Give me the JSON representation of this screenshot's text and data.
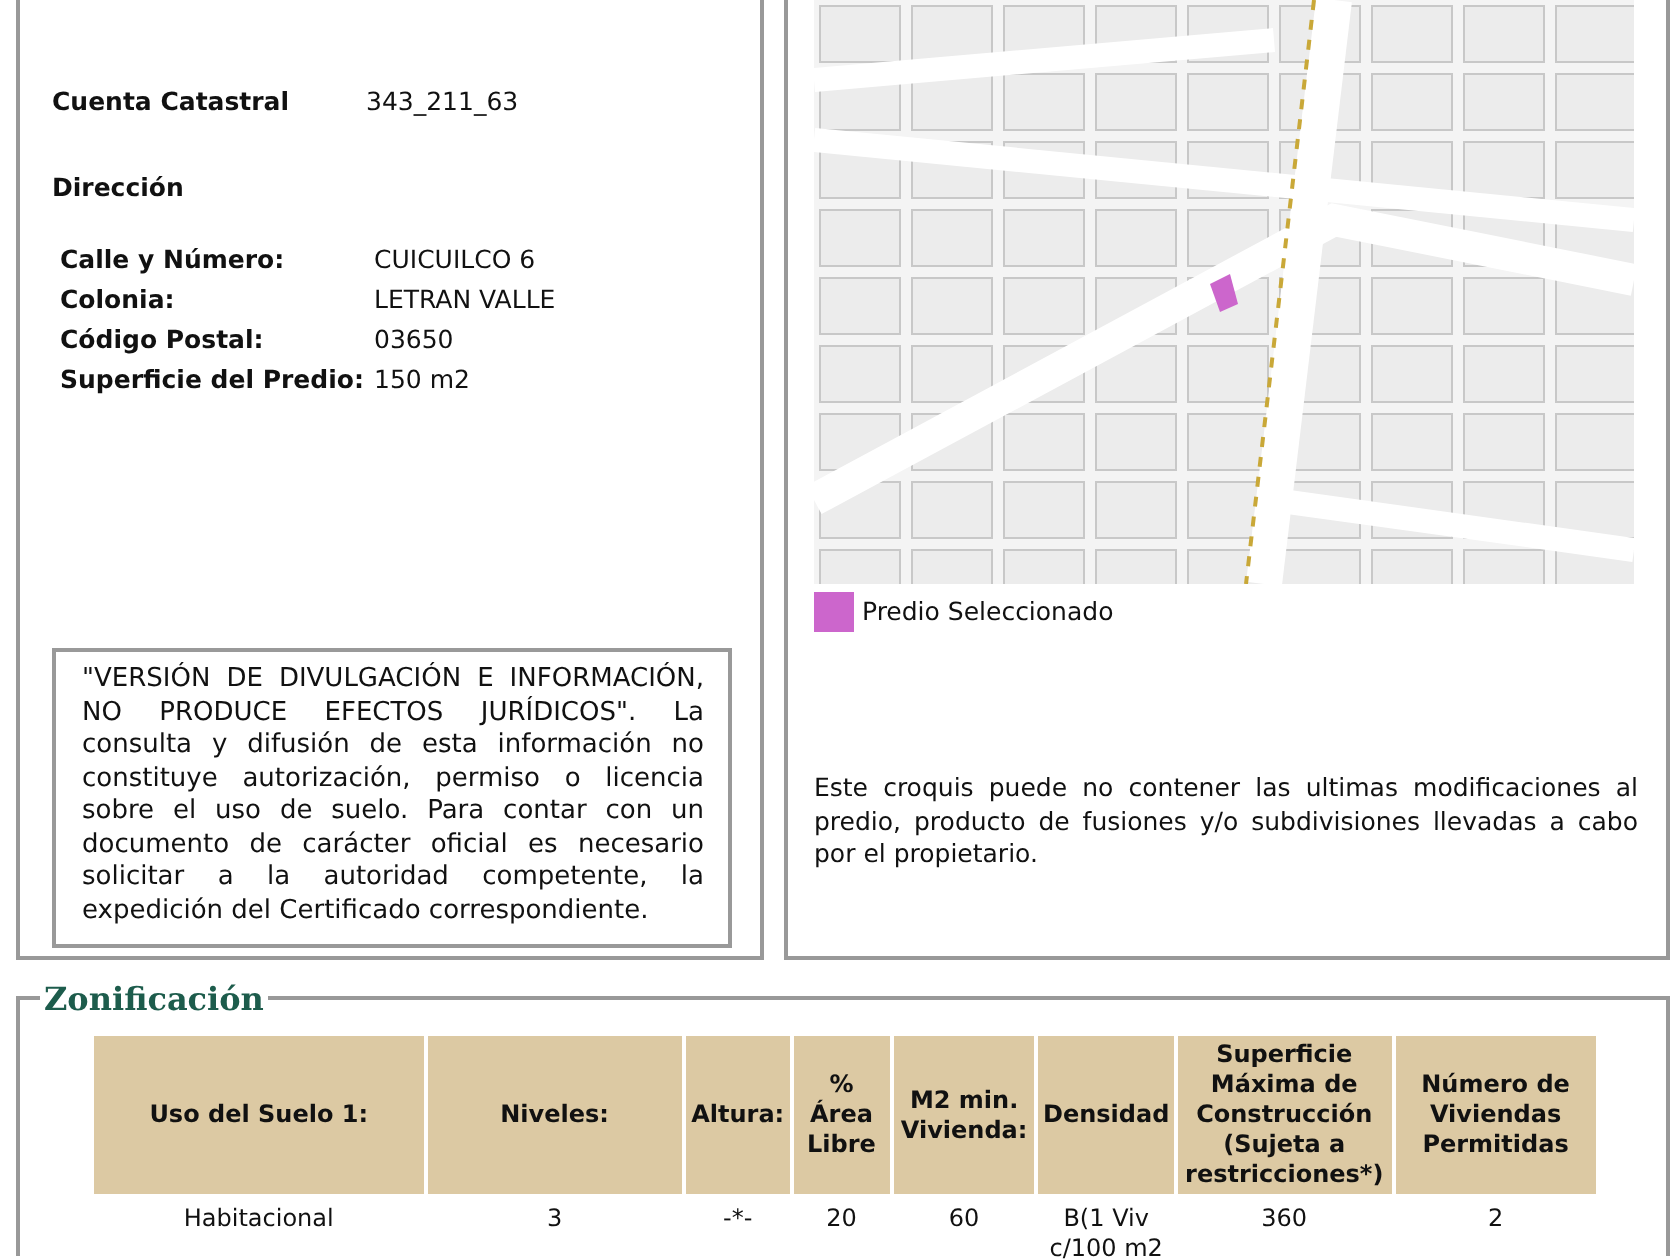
{
  "predio": {
    "cuenta_label": "Cuenta Catastral",
    "cuenta_value": "343_211_63",
    "direccion_heading": "Dirección",
    "fields": [
      {
        "label": "Calle y Número:",
        "value": "CUICUILCO 6"
      },
      {
        "label": "Colonia:",
        "value": "LETRAN VALLE"
      },
      {
        "label": "Código Postal:",
        "value": "03650"
      },
      {
        "label": "Superficie del Predio:",
        "value": "150 m2"
      }
    ],
    "disclaimer": "\"VERSIÓN DE DIVULGACIÓN E INFORMACIÓN, NO PRODUCE EFECTOS JURÍDICOS\". La consulta y difusión de esta información no constituye autorización, permiso o licencia sobre el uso de suelo. Para contar con un documento de carácter oficial es necesario solicitar a la autoridad competente, la expedición del Certificado correspondiente."
  },
  "map": {
    "kind": "picture",
    "legend": {
      "label": "Predio Seleccionado",
      "color": "#cc66cc"
    },
    "note": "Este croquis puede no contener las ultimas modificaciones al predio, producto de fusiones y/o subdivisiones llevadas a cabo por el propietario."
  },
  "zonificacion": {
    "title": "Zonificación",
    "columns": [
      "Uso del Suelo 1:",
      "Niveles:",
      "Altura:",
      "% Área Libre",
      "M2 min. Vivienda:",
      "Densidad",
      "Superficie Máxima de Construcción (Sujeta a restricciones*)",
      "Número de Viviendas Permitidas"
    ],
    "rows": [
      [
        "Habitacional",
        "3",
        "-*-",
        "20",
        "60",
        "B(1 Viv c/100 m2",
        "360",
        "2"
      ]
    ]
  }
}
